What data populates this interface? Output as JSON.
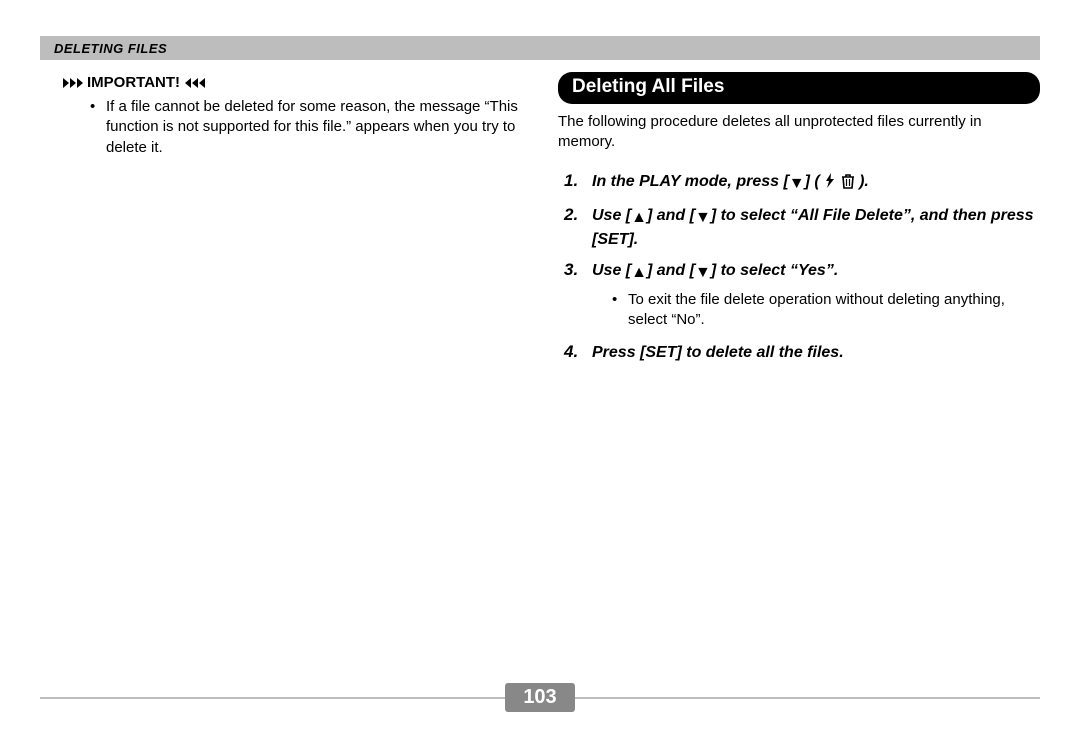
{
  "header": {
    "title": "DELETING FILES"
  },
  "left": {
    "important_label": "IMPORTANT!",
    "bullet": "If a file cannot be deleted for some reason, the message “This function is not supported for this file.” appears when you try to delete it."
  },
  "right": {
    "section_title": "Deleting All Files",
    "intro": "The following procedure deletes all unprotected files currently in memory.",
    "steps": {
      "s1_num": "1.",
      "s1_pre": "In the PLAY mode, press [",
      "s1_post": "] ( ",
      "s1_end": " ).",
      "s2_num": "2.",
      "s2_a": "Use [",
      "s2_b": "] and [",
      "s2_c": "] to select “All File Delete”, and then press [SET].",
      "s3_num": "3.",
      "s3_a": "Use [",
      "s3_b": "] and [",
      "s3_c": "] to select “Yes”.",
      "s3_sub": "To exit the file delete operation without deleting anything, select “No”.",
      "s4_num": "4.",
      "s4": "Press [SET] to delete all the files."
    }
  },
  "page_number": "103"
}
